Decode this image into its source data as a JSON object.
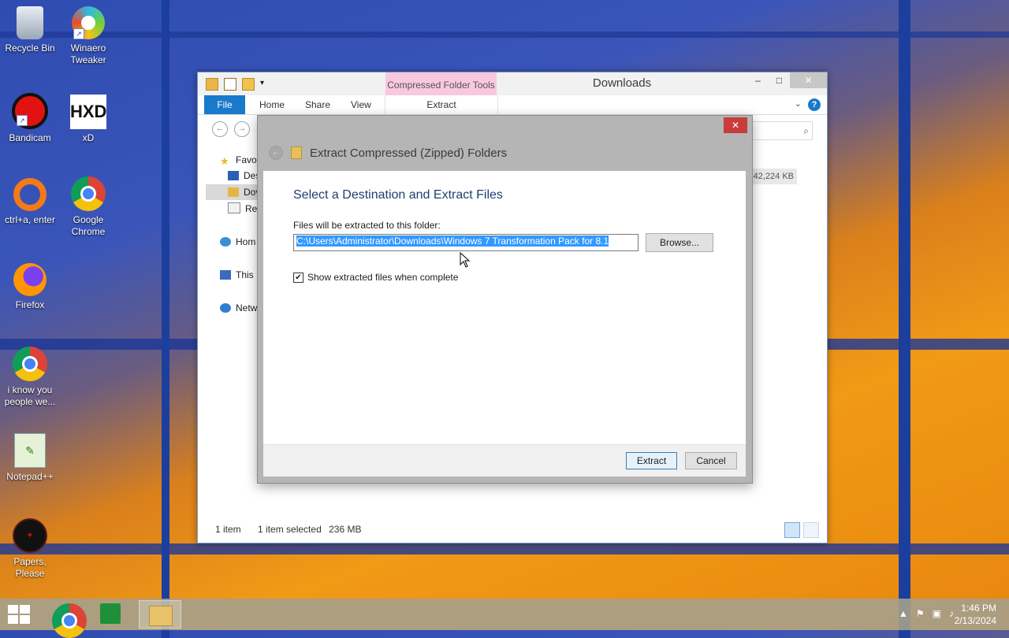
{
  "desktop": {
    "icons": [
      {
        "label": "Recycle Bin"
      },
      {
        "label": "Winaero Tweaker"
      },
      {
        "label": "Bandicam"
      },
      {
        "label": "xD"
      },
      {
        "label": "ctrl+a, enter"
      },
      {
        "label": "Google Chrome"
      },
      {
        "label": "Firefox"
      },
      {
        "label": "i know you people we..."
      },
      {
        "label": "Notepad++"
      },
      {
        "label": "Papers, Please"
      }
    ],
    "hxd_glyph": "HXD"
  },
  "explorer": {
    "title": "Downloads",
    "context_tab": "Compressed Folder Tools",
    "ribbon": {
      "file": "File",
      "home": "Home",
      "share": "Share",
      "view": "View",
      "extract": "Extract"
    },
    "sidebar": {
      "favorites": "Favor",
      "desktop": "Des",
      "downloads": "Dov",
      "recent": "Rec",
      "homegroup": "Hom",
      "this_pc": "This",
      "network": "Netw"
    },
    "size_cell": "42,224 KB",
    "status": {
      "items": "1 item",
      "selected": "1 item selected",
      "size": "236 MB"
    }
  },
  "dialog": {
    "title": "Extract Compressed (Zipped) Folders",
    "heading": "Select a Destination and Extract Files",
    "destination_label": "Files will be extracted to this folder:",
    "destination_value": "C:\\Users\\Administrator\\Downloads\\Windows 7 Transformation Pack for 8.1",
    "browse_label": "Browse...",
    "show_files_label": "Show extracted files when complete",
    "show_files_checked": true,
    "extract_label": "Extract",
    "cancel_label": "Cancel"
  },
  "taskbar": {
    "time": "1:46 PM",
    "date": "2/13/2024"
  },
  "colors": {
    "accent": "#1979ca",
    "selection": "#3399ff",
    "context_tab": "#f8c8df",
    "close_red": "#c83c3c"
  }
}
